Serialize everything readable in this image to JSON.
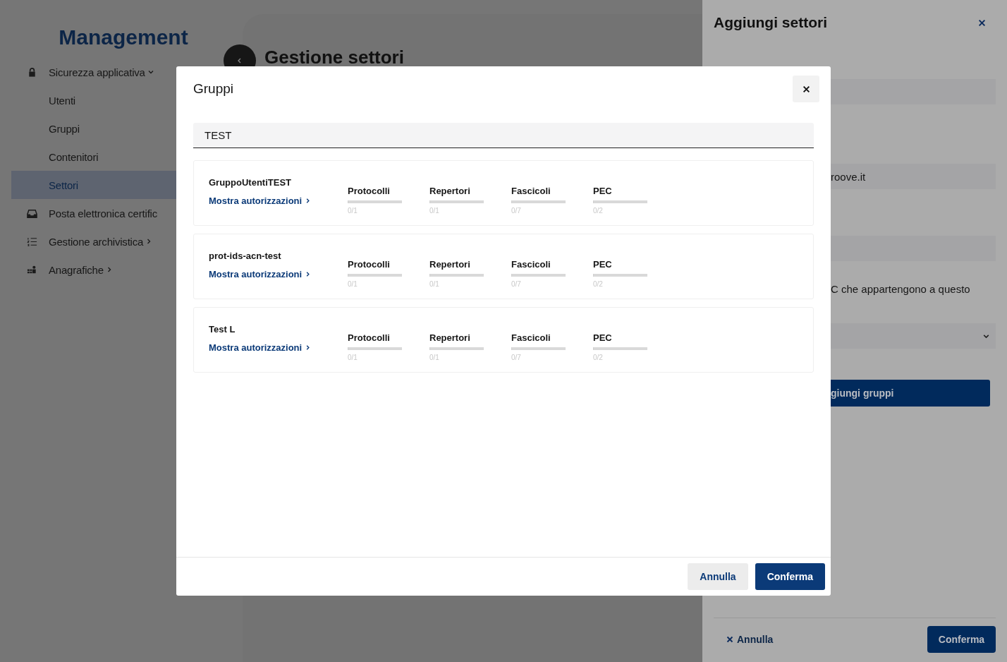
{
  "sidebar": {
    "title": "Management",
    "items": [
      {
        "label": "Sicurezza applicativa",
        "expanded": true,
        "selected": false,
        "children": [
          {
            "label": "Utenti",
            "selected": false
          },
          {
            "label": "Gruppi",
            "selected": false
          },
          {
            "label": "Contenitori",
            "selected": false
          },
          {
            "label": "Settori",
            "selected": true
          }
        ]
      },
      {
        "label": "Posta elettronica certific",
        "selected": false
      },
      {
        "label": "Gestione archivistica",
        "expanded": false,
        "selected": false
      },
      {
        "label": "Anagrafiche",
        "expanded": false,
        "selected": false
      }
    ]
  },
  "page": {
    "title": "Gestione settori"
  },
  "drawer": {
    "title": "Aggiungi settori",
    "items": [
      {
        "kind": "input"
      },
      {
        "kind": "input",
        "value": "roove.it"
      },
      {
        "kind": "input"
      },
      {
        "kind": "text",
        "text": "C che appartengono a questo"
      },
      {
        "kind": "select"
      },
      {
        "kind": "button",
        "text": "giungi gruppi"
      }
    ],
    "cancel": "Annulla",
    "confirm": "Conferma"
  },
  "modal": {
    "title": "Gruppi",
    "search": {
      "value": "TEST"
    },
    "groups": [
      {
        "name": "GruppoUtentiTEST",
        "link": "Mostra autorizzazioni",
        "stats": [
          {
            "label": "Protocolli",
            "level": 0,
            "reading": "0/1"
          },
          {
            "label": "Repertori",
            "level": 0,
            "reading": "0/1"
          },
          {
            "label": "Fascicoli",
            "level": 0,
            "reading": "0/7"
          },
          {
            "label": "PEC",
            "level": 0,
            "reading": "0/2"
          }
        ]
      },
      {
        "name": "prot-ids-acn-test",
        "link": "Mostra autorizzazioni",
        "stats": [
          {
            "label": "Protocolli",
            "level": 0,
            "reading": "0/1"
          },
          {
            "label": "Repertori",
            "level": 0,
            "reading": "0/1"
          },
          {
            "label": "Fascicoli",
            "level": 0,
            "reading": "0/7"
          },
          {
            "label": "PEC",
            "level": 0,
            "reading": "0/2"
          }
        ]
      },
      {
        "name": "Test L",
        "link": "Mostra autorizzazioni",
        "stats": [
          {
            "label": "Protocolli",
            "level": 0,
            "reading": "0/1"
          },
          {
            "label": "Repertori",
            "level": 0,
            "reading": "0/1"
          },
          {
            "label": "Fascicoli",
            "level": 0,
            "reading": "0/7"
          },
          {
            "label": "PEC",
            "level": 0,
            "reading": "0/2"
          }
        ]
      }
    ],
    "buttons": [
      {
        "label": "Annulla",
        "kind": "secondary"
      },
      {
        "label": "Conferma",
        "kind": "primary"
      }
    ]
  }
}
